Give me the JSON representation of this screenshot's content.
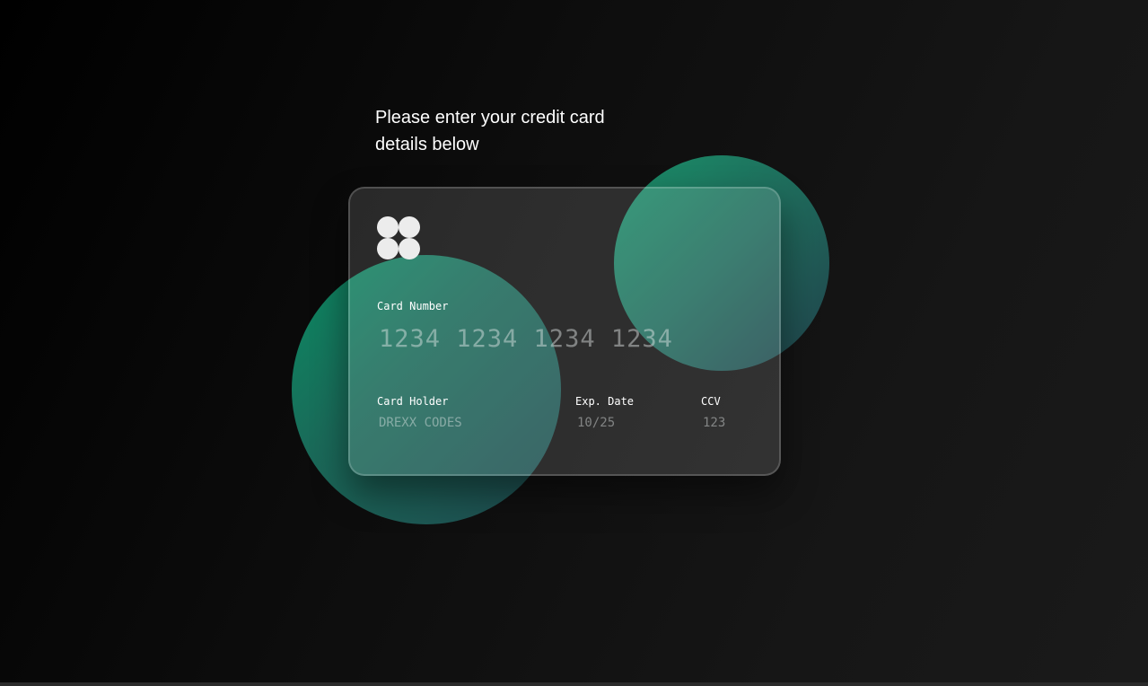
{
  "heading": "Please enter your credit card details below",
  "card": {
    "logo_icon": "four-circles-logo-icon",
    "number_label": "Card Number",
    "number_placeholder": "1234 1234 1234 1234",
    "holder_label": "Card Holder",
    "holder_placeholder": "DREXX CODES",
    "exp_label": "Exp. Date",
    "exp_placeholder": "10/25",
    "ccv_label": "CCV",
    "ccv_placeholder": "123"
  },
  "colors": {
    "background": "#0d0d0d",
    "accent_green": "#0b8a62",
    "text": "#ffffff"
  }
}
